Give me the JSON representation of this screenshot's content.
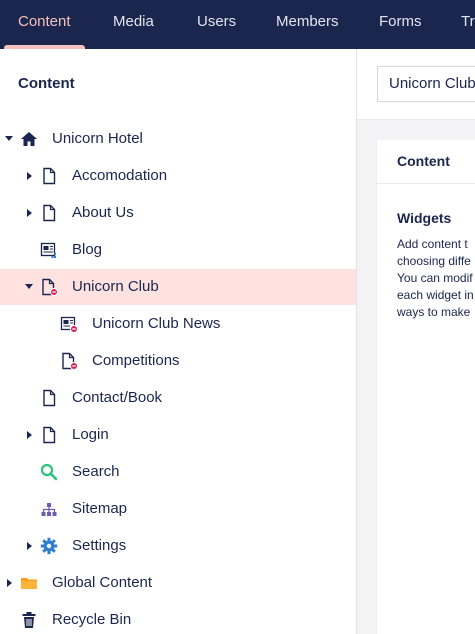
{
  "topnav": {
    "tabs": [
      {
        "label": "Content",
        "active": true
      },
      {
        "label": "Media"
      },
      {
        "label": "Users"
      },
      {
        "label": "Members"
      },
      {
        "label": "Forms"
      },
      {
        "label": "Tr"
      }
    ]
  },
  "sidebar": {
    "title": "Content",
    "tree": [
      {
        "label": "Unicorn Hotel",
        "icon": "home-icon",
        "caret": "down"
      },
      {
        "label": "Accomodation",
        "icon": "document-icon",
        "caret": "right"
      },
      {
        "label": "About Us",
        "icon": "document-icon",
        "caret": "right"
      },
      {
        "label": "Blog",
        "icon": "newspaper-icon"
      },
      {
        "label": "Unicorn Club",
        "icon": "document-restricted-icon",
        "caret": "down",
        "selected": true
      },
      {
        "label": "Unicorn Club News",
        "icon": "newspaper-restricted-icon"
      },
      {
        "label": "Competitions",
        "icon": "document-restricted-icon"
      },
      {
        "label": "Contact/Book",
        "icon": "document-icon"
      },
      {
        "label": "Login",
        "icon": "document-icon",
        "caret": "right"
      },
      {
        "label": "Search",
        "icon": "search-icon"
      },
      {
        "label": "Sitemap",
        "icon": "sitemap-icon"
      },
      {
        "label": "Settings",
        "icon": "gear-icon",
        "caret": "right"
      },
      {
        "label": "Global Content",
        "icon": "folder-icon",
        "caret": "right"
      },
      {
        "label": "Recycle Bin",
        "icon": "trash-icon"
      }
    ]
  },
  "main": {
    "name_value": "Unicorn Club",
    "card_title": "Content",
    "widgets_title": "Widgets",
    "description_lines": [
      "Add content t",
      "choosing diffe",
      "You can modif",
      "each widget in",
      "ways to make"
    ]
  },
  "colors": {
    "nav_bg": "#1b264f",
    "nav_active": "#f5c1bc",
    "selected_bg": "#fde2df",
    "restricted_badge": "#d42054",
    "search_green": "#2bc37c",
    "sitemap_purple": "#6f5bb5",
    "gear_blue": "#2e7fd1",
    "folder_orange": "#f9a11b"
  }
}
